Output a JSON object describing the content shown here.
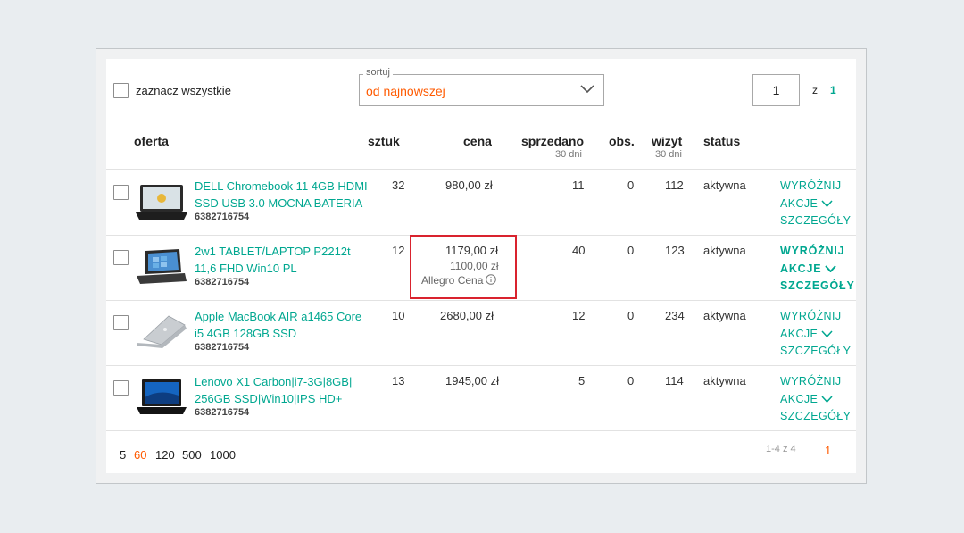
{
  "toolbar": {
    "select_all_label": "zaznacz wszystkie",
    "sort_legend": "sortuj",
    "sort_value": "od najnowszej",
    "page_current": "1",
    "page_of": "z",
    "page_total": "1"
  },
  "columns": {
    "offer": "oferta",
    "qty": "sztuk",
    "price": "cena",
    "sold": "sprzedano",
    "sold_sub": "30 dni",
    "watch": "obs.",
    "visits": "wizyt",
    "visits_sub": "30 dni",
    "status": "status"
  },
  "rows": [
    {
      "title_line1": "DELL Chromebook 11 4GB HDMI",
      "title_line2": "SSD USB 3.0 MOCNA BATERIA",
      "sku": "6382716754",
      "qty": "32",
      "price": "980,00 zł",
      "sold": "11",
      "watch": "0",
      "visits": "112",
      "status": "aktywna",
      "thumb_icon": "laptop-chromebook-icon"
    },
    {
      "title_line1": "2w1 TABLET/LAPTOP P2212t",
      "title_line2": "11,6 FHD Win10 PL",
      "sku": "6382716754",
      "qty": "12",
      "price": "1179,00 zł",
      "price_sub": "1100,00 zł",
      "price_note": "Allegro Cena",
      "sold": "40",
      "watch": "0",
      "visits": "123",
      "status": "aktywna",
      "thumb_icon": "laptop-tablet-icon"
    },
    {
      "title_line1": "Apple MacBook AIR a1465 Core",
      "title_line2": "i5 4GB 128GB SSD",
      "sku": "6382716754",
      "qty": "10",
      "price": "2680,00 zł",
      "sold": "12",
      "watch": "0",
      "visits": "234",
      "status": "aktywna",
      "thumb_icon": "laptop-macbook-icon"
    },
    {
      "title_line1": "Lenovo X1 Carbon|i7-3G|8GB|",
      "title_line2": "256GB SSD|Win10|IPS HD+",
      "sku": "6382716754",
      "qty": "13",
      "price": "1945,00 zł",
      "sold": "5",
      "watch": "0",
      "visits": "114",
      "status": "aktywna",
      "thumb_icon": "laptop-lenovo-icon"
    }
  ],
  "actions": {
    "highlight": "WYRÓŻNIJ",
    "actions": "AKCJE",
    "details": "SZCZEGÓŁY"
  },
  "footer": {
    "per_page": [
      "5",
      "60",
      "120",
      "500",
      "1000"
    ],
    "per_page_active": "60",
    "range": "1-4 z 4",
    "current_page": "1"
  },
  "colors": {
    "accent": "#00a790",
    "orange": "#ff5a00",
    "highlight_border": "#d9232e"
  }
}
